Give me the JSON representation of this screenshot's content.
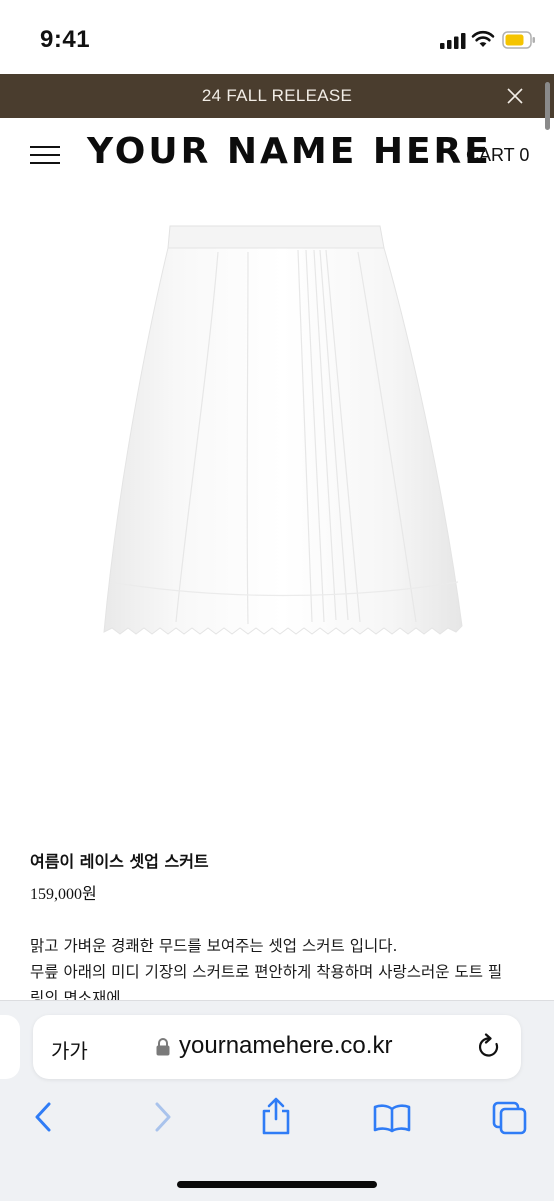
{
  "status_bar": {
    "time": "9:41"
  },
  "announcement": {
    "text": "24 FALL RELEASE",
    "background": "#4a3d2e"
  },
  "header": {
    "logo": "YOUR NAME HERE",
    "cart": "CART 0"
  },
  "product": {
    "name": "여름이 레이스 셋업 스커트",
    "price": "159,000원",
    "description_lines": [
      "맑고 가벼운 경쾌한 무드를 보여주는 셋업 스커트 입니다.",
      "무릎 아래의 미디 기장의 스커트로 편안하게 착용하며 사랑스러운 도트 필",
      "링의 면소재에"
    ]
  },
  "browser": {
    "text_size_label": "가가",
    "url": "yournamehere.co.kr",
    "accent": "#2f7cf6",
    "toolbar_icons": [
      "back-icon",
      "forward-icon",
      "share-icon",
      "bookmarks-icon",
      "tabs-icon"
    ]
  }
}
